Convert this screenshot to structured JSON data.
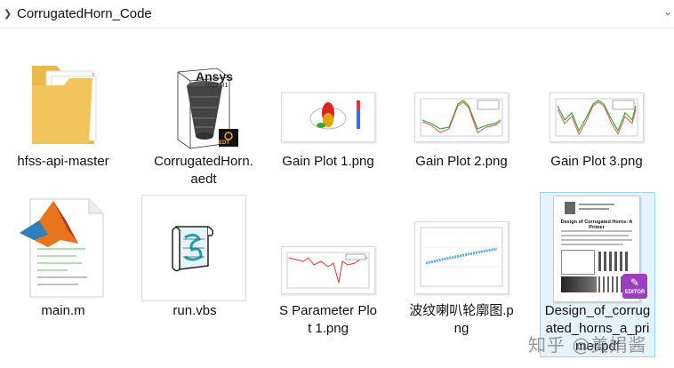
{
  "address_bar": {
    "path": "CorrugatedHorn_Code"
  },
  "files": [
    {
      "name": "hfss-api-master",
      "kind": "folder"
    },
    {
      "name": "CorrugatedHorn.aedt",
      "kind": "aedt",
      "thumb_text_1": "Ansys",
      "thumb_text_2": "2023 R1",
      "thumb_badge": "EDT"
    },
    {
      "name": "Gain Plot 1.png",
      "kind": "png"
    },
    {
      "name": "Gain Plot 2.png",
      "kind": "png"
    },
    {
      "name": "Gain Plot 3.png",
      "kind": "png"
    },
    {
      "name": "main.m",
      "kind": "matlab"
    },
    {
      "name": "run.vbs",
      "kind": "vbs"
    },
    {
      "name": "S Parameter Plot 1.png",
      "kind": "png"
    },
    {
      "name": "波纹喇叭轮廓图.png",
      "kind": "png"
    },
    {
      "name": "Design_of_corrugated_horns_a_primer.pdf",
      "kind": "pdf",
      "thumb_title": "Design of Corrugated Horns: A Primer",
      "thumb_badge": "EDITOR",
      "selected": true
    }
  ],
  "watermark": "知乎 @美娟酱",
  "colors": {
    "selection_fill": "#e5f3ff",
    "selection_border": "#99d1ff",
    "folder": "#f2c55c",
    "pdf_badge": "#9b3fbf"
  }
}
